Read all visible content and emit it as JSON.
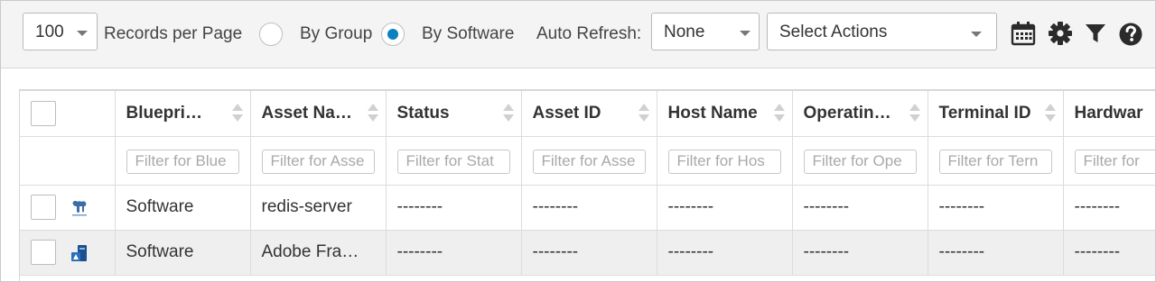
{
  "toolbar": {
    "records_per_page_value": "100",
    "records_per_page_label": "Records per Page",
    "by_group_label": "By Group",
    "by_software_label": "By Software",
    "selected_view": "By Software",
    "auto_refresh_label": "Auto Refresh:",
    "auto_refresh_value": "None",
    "actions_placeholder": "Select Actions",
    "icons": [
      "calendar-icon",
      "gear-icon",
      "filter-icon",
      "help-icon"
    ]
  },
  "colors": {
    "radio_selected": "#0a7fc1",
    "icon": "#2b2b2b",
    "row_alt": "#efefef"
  },
  "table": {
    "columns": [
      {
        "label": "Bluepri…",
        "filter_placeholder": "Filter for Blue"
      },
      {
        "label": "Asset Na…",
        "filter_placeholder": "Filter for Asse"
      },
      {
        "label": "Status",
        "filter_placeholder": "Filter for Stat"
      },
      {
        "label": "Asset ID",
        "filter_placeholder": "Filter for Asse"
      },
      {
        "label": "Host Name",
        "filter_placeholder": "Filter for Hos"
      },
      {
        "label": "Operatin…",
        "filter_placeholder": "Filter for Ope"
      },
      {
        "label": "Terminal ID",
        "filter_placeholder": "Filter for Tern"
      },
      {
        "label": "Hardwar",
        "filter_placeholder": "Filter for"
      }
    ],
    "rows": [
      {
        "icon": "redis-logo-icon",
        "cells": [
          "Software",
          "redis-server",
          "--------",
          "--------",
          "--------",
          "--------",
          "--------",
          "--------"
        ]
      },
      {
        "icon": "adobe-software-icon",
        "cells": [
          "Software",
          "Adobe Fra…",
          "--------",
          "--------",
          "--------",
          "--------",
          "--------",
          "--------"
        ]
      }
    ]
  }
}
